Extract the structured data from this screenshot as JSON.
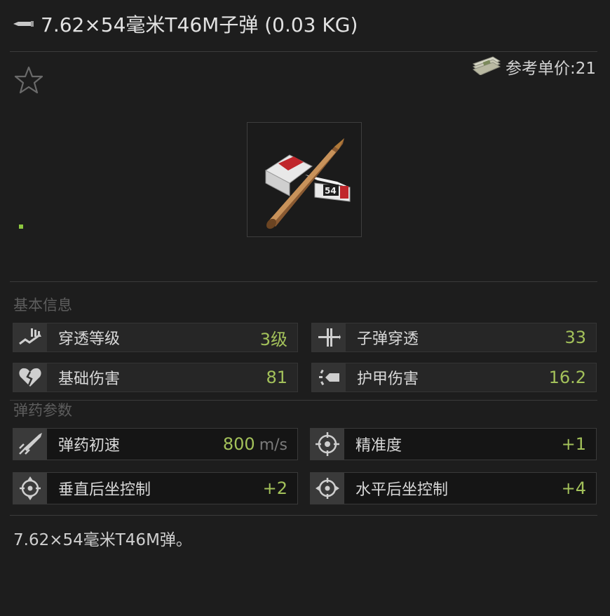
{
  "header": {
    "title": "7.62×54毫米T46M子弹 (0.03 KG)",
    "icon": "bullet-icon"
  },
  "price": {
    "label": "参考单价:21",
    "icon": "money-stack-icon"
  },
  "favorite": {
    "icon": "star-outline-icon"
  },
  "item": {
    "icon": "ammo-box-with-round",
    "box_label": "54"
  },
  "sections": {
    "basic": "基本信息",
    "ammo": "弹药参数"
  },
  "stats": {
    "penetration_level": {
      "label": "穿透等级",
      "value": "3级",
      "icon": "penetration-level-icon"
    },
    "bullet_penetration": {
      "label": "子弹穿透",
      "value": "33",
      "icon": "bullet-penetration-icon"
    },
    "base_damage": {
      "label": "基础伤害",
      "value": "81",
      "icon": "broken-heart-icon"
    },
    "armor_damage": {
      "label": "护甲伤害",
      "value": "16.2",
      "icon": "armor-damage-icon"
    },
    "muzzle_velocity": {
      "label": "弹药初速",
      "value": "800",
      "unit": "m/s",
      "icon": "velocity-icon"
    },
    "accuracy": {
      "label": "精准度",
      "value": "+1",
      "icon": "crosshair-icon"
    },
    "vertical_recoil": {
      "label": "垂直后坐控制",
      "value": "+2",
      "icon": "vertical-recoil-icon"
    },
    "horizontal_recoil": {
      "label": "水平后坐控制",
      "value": "+4",
      "icon": "horizontal-recoil-icon"
    }
  },
  "colors": {
    "value_green": "#a3c15a",
    "background": "#1d1d1d",
    "muted": "#5d5d5d"
  },
  "description": "7.62×54毫米T46M弹。"
}
